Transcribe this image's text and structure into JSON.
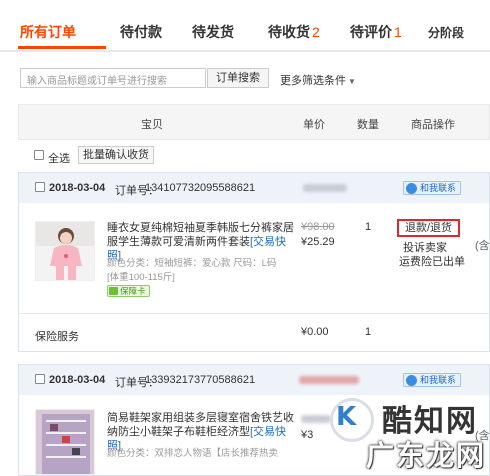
{
  "tabs": [
    {
      "label": "所有订单",
      "count": ""
    },
    {
      "label": "待付款",
      "count": ""
    },
    {
      "label": "待发货",
      "count": ""
    },
    {
      "label": "待收货",
      "count": "2"
    },
    {
      "label": "待评价",
      "count": "1"
    },
    {
      "label": "分阶段",
      "count": ""
    }
  ],
  "search": {
    "placeholder": "输入商品标题或订单号进行搜索",
    "button": "订单搜索",
    "more_filters": "更多筛选条件"
  },
  "table_header": {
    "product": "宝贝",
    "price": "单价",
    "quantity": "数量",
    "operation": "商品操作"
  },
  "batch": {
    "select_all": "全选",
    "confirm_button": "批量确认收货"
  },
  "orders": [
    {
      "date": "2018-03-04",
      "order_no_label": "订单号：",
      "order_no": "134107732095588621",
      "contact": "和我联系",
      "title": "睡衣女夏纯棉短袖夏季韩版七分裤家居服学生薄款可爱清新两件套装",
      "title_tag": "[交易快照]",
      "attr_line1": "颜色分类：短袖短裤：爱心款  尺码：L码",
      "attr_line2": "[体重100-115斤]",
      "guarantee": "保障卡",
      "price_old": "¥98.00",
      "price": "¥25.29",
      "quantity": "1",
      "refund": "退款/退货",
      "complain": "投诉卖家",
      "insurance": "运费险已出单",
      "side_cut": "(含",
      "service_label": "保险服务",
      "service_price": "¥0.00",
      "service_qty": "1"
    },
    {
      "date": "2018-03-04",
      "order_no_label": "订单号：",
      "order_no": "133932173770588621",
      "contact": "和我联系",
      "title": "简易鞋架家用组装多层寝室宿舍铁艺收纳防尘小鞋架子布鞋柜经济型",
      "title_tag": "[交易快照]",
      "attr_line1": "颜色分类：双排恋人物语【店长推荐热卖",
      "price_partial": "¥3",
      "side_cut": "(含"
    }
  ],
  "watermark": {
    "line1": "酷知网",
    "line2": "广东龙网"
  }
}
